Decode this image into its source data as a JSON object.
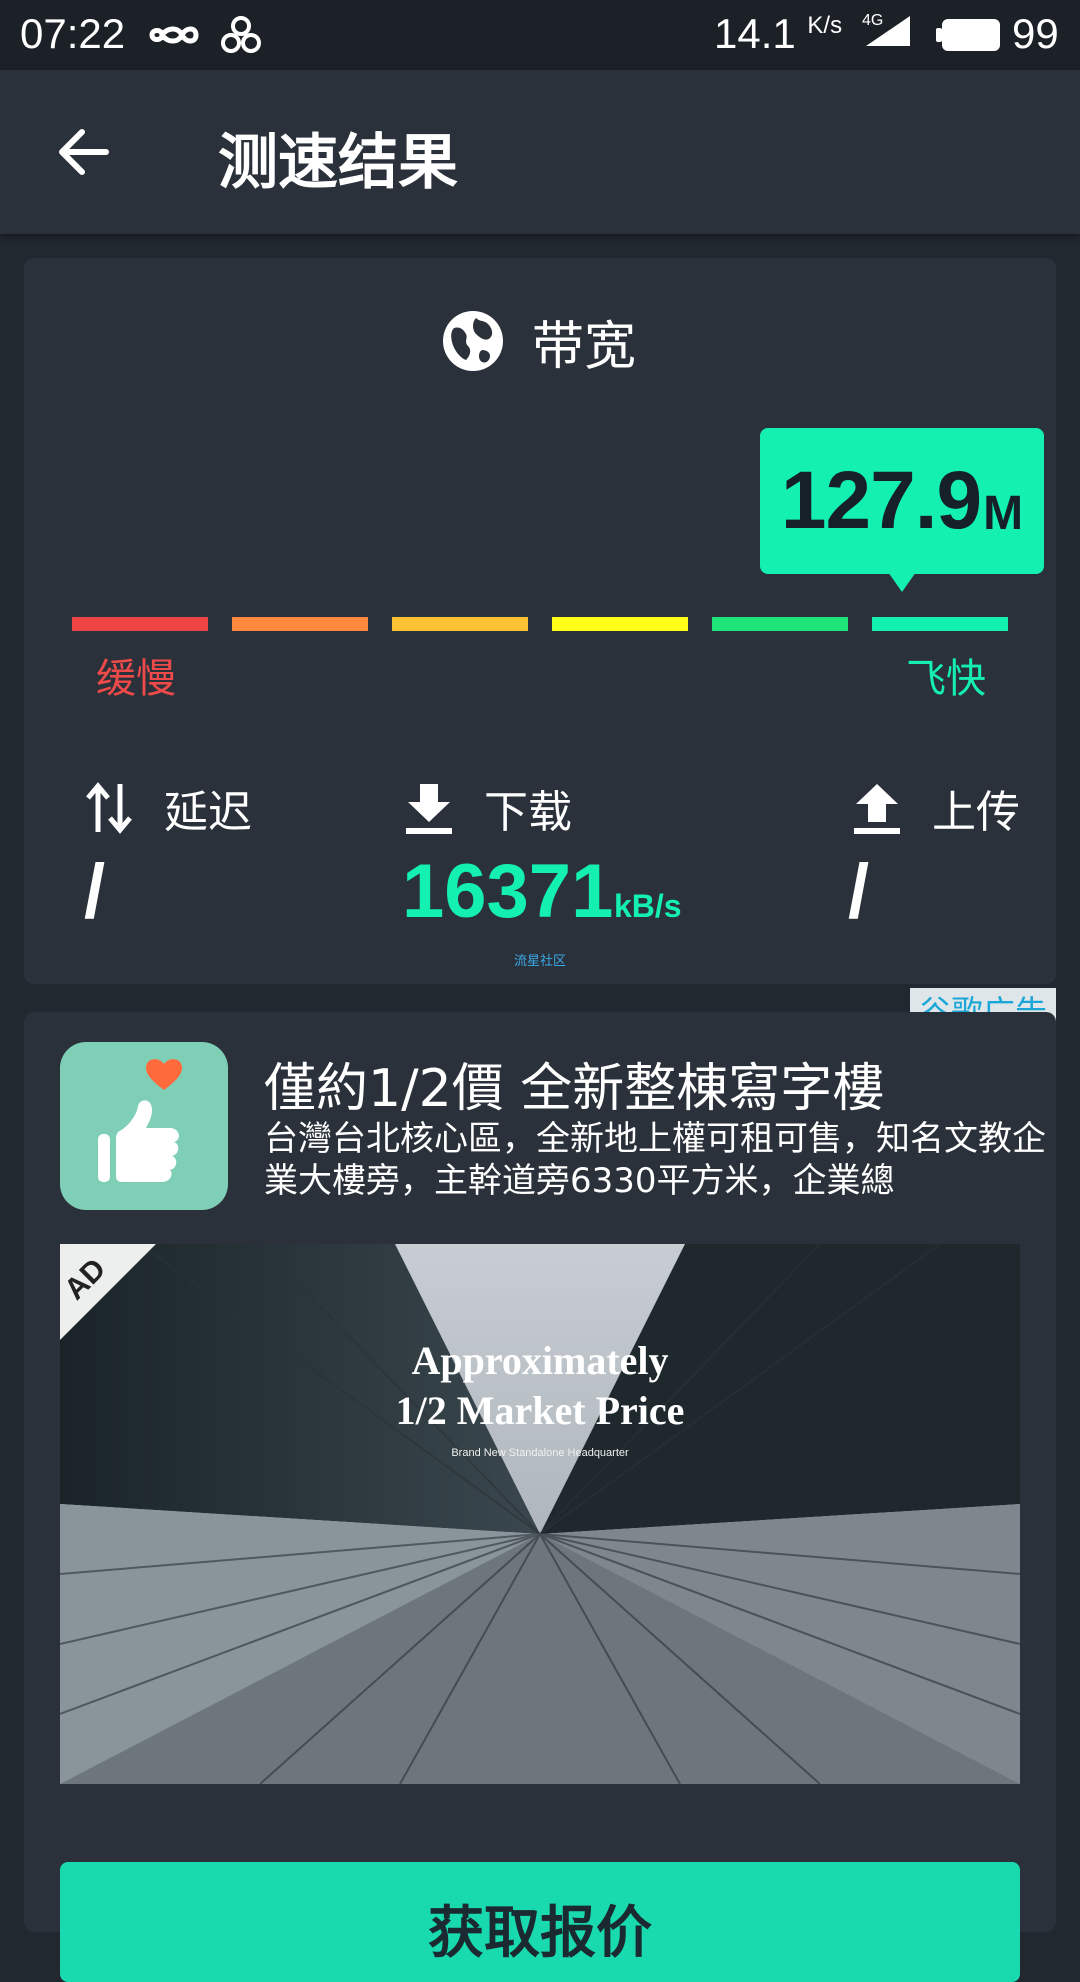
{
  "status_bar": {
    "time": "07:22",
    "net_speed": "14.1",
    "net_unit": "K/s",
    "network": "4G",
    "battery": "99",
    "icons": [
      "infinity-icon",
      "pinwheel-icon",
      "signal-icon",
      "battery-icon"
    ]
  },
  "app_bar": {
    "title": "测速结果"
  },
  "bandwidth": {
    "title": "带宽",
    "value": "127.9",
    "unit": "M",
    "scale": {
      "slow_label": "缓慢",
      "fast_label": "飞快",
      "colors": [
        "#ef4444",
        "#ff8a3d",
        "#ffc233",
        "#ffff1a",
        "#1ee27a",
        "#13f0b0"
      ],
      "active_segment": 6
    }
  },
  "metrics": {
    "latency": {
      "label": "延迟",
      "value": "/"
    },
    "download": {
      "label": "下载",
      "value": "16371",
      "unit": "kB/s"
    },
    "upload": {
      "label": "上传",
      "value": "/"
    }
  },
  "watermark": "流星社区",
  "ad": {
    "badge": "谷歌广告",
    "headline": "僅約1/2價 全新整棟寫字樓",
    "body": "台灣台北核心區，全新地上權可租可售，知名文教企業大樓旁，主幹道旁6330平方米，企業總",
    "image": {
      "corner": "AD",
      "line1": "Approximately",
      "line2": "1/2 Market Price",
      "line3": "Brand New Standalone Headquarter"
    },
    "cta": "获取报价"
  },
  "accent": "#13f0b0"
}
